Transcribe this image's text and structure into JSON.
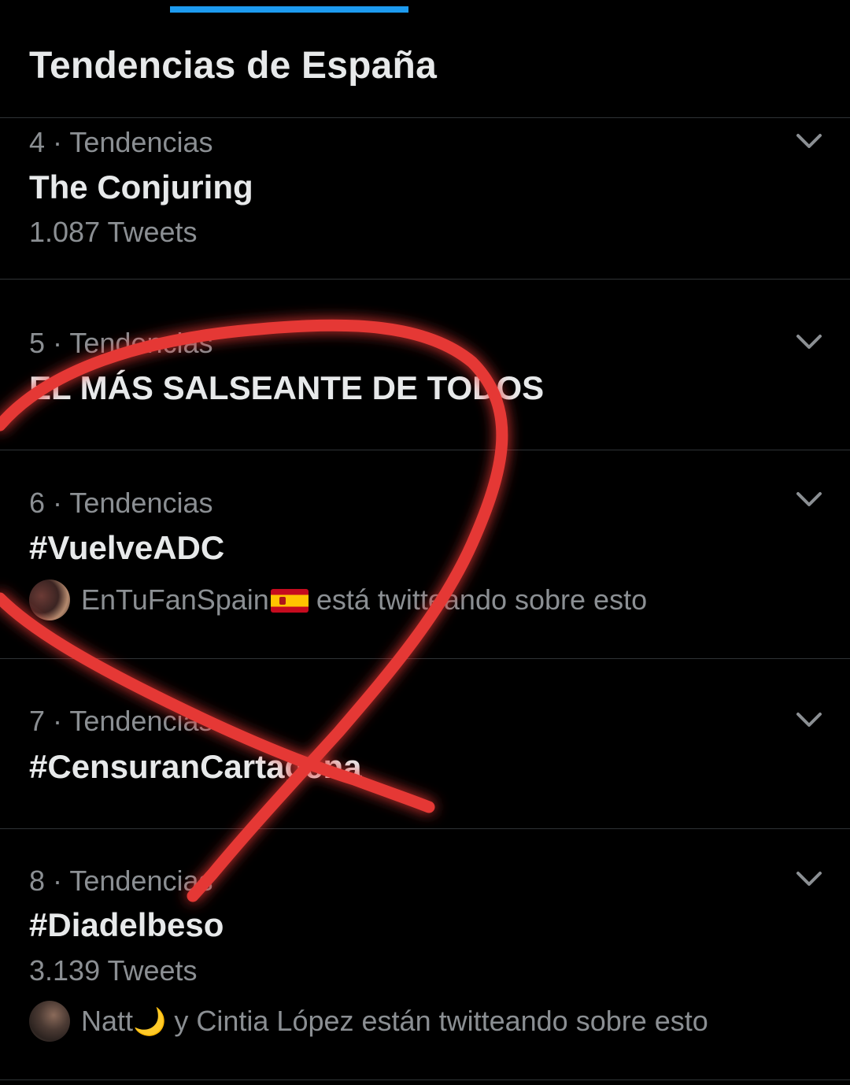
{
  "header": {
    "title": "Tendencias de España"
  },
  "colors": {
    "background": "#000000",
    "accent": "#1d9bf0",
    "annotation": "#e53935"
  },
  "trends": [
    {
      "meta": "4 · Tendencias",
      "title": "The Conjuring",
      "count": "1.087 Tweets"
    },
    {
      "meta": "5 · Tendencias",
      "title": "EL MÁS SALSEANTE DE TODOS"
    },
    {
      "meta": "6 · Tendencias",
      "title": "#VuelveADC",
      "tweeting": {
        "name": "EnTuFanSpain",
        "flag_icon": "spain-flag-icon",
        "suffix": "está twitteando sobre esto"
      }
    },
    {
      "meta": "7 · Tendencias",
      "title": "#CensuranCartagena"
    },
    {
      "meta": "8 · Tendencias",
      "title": "#Diadelbeso",
      "count": "3.139 Tweets",
      "tweeting": {
        "name": "Natt",
        "moon_icon": "crescent-moon-icon",
        "suffix": "y Cintia López están twitteando sobre esto"
      }
    }
  ]
}
